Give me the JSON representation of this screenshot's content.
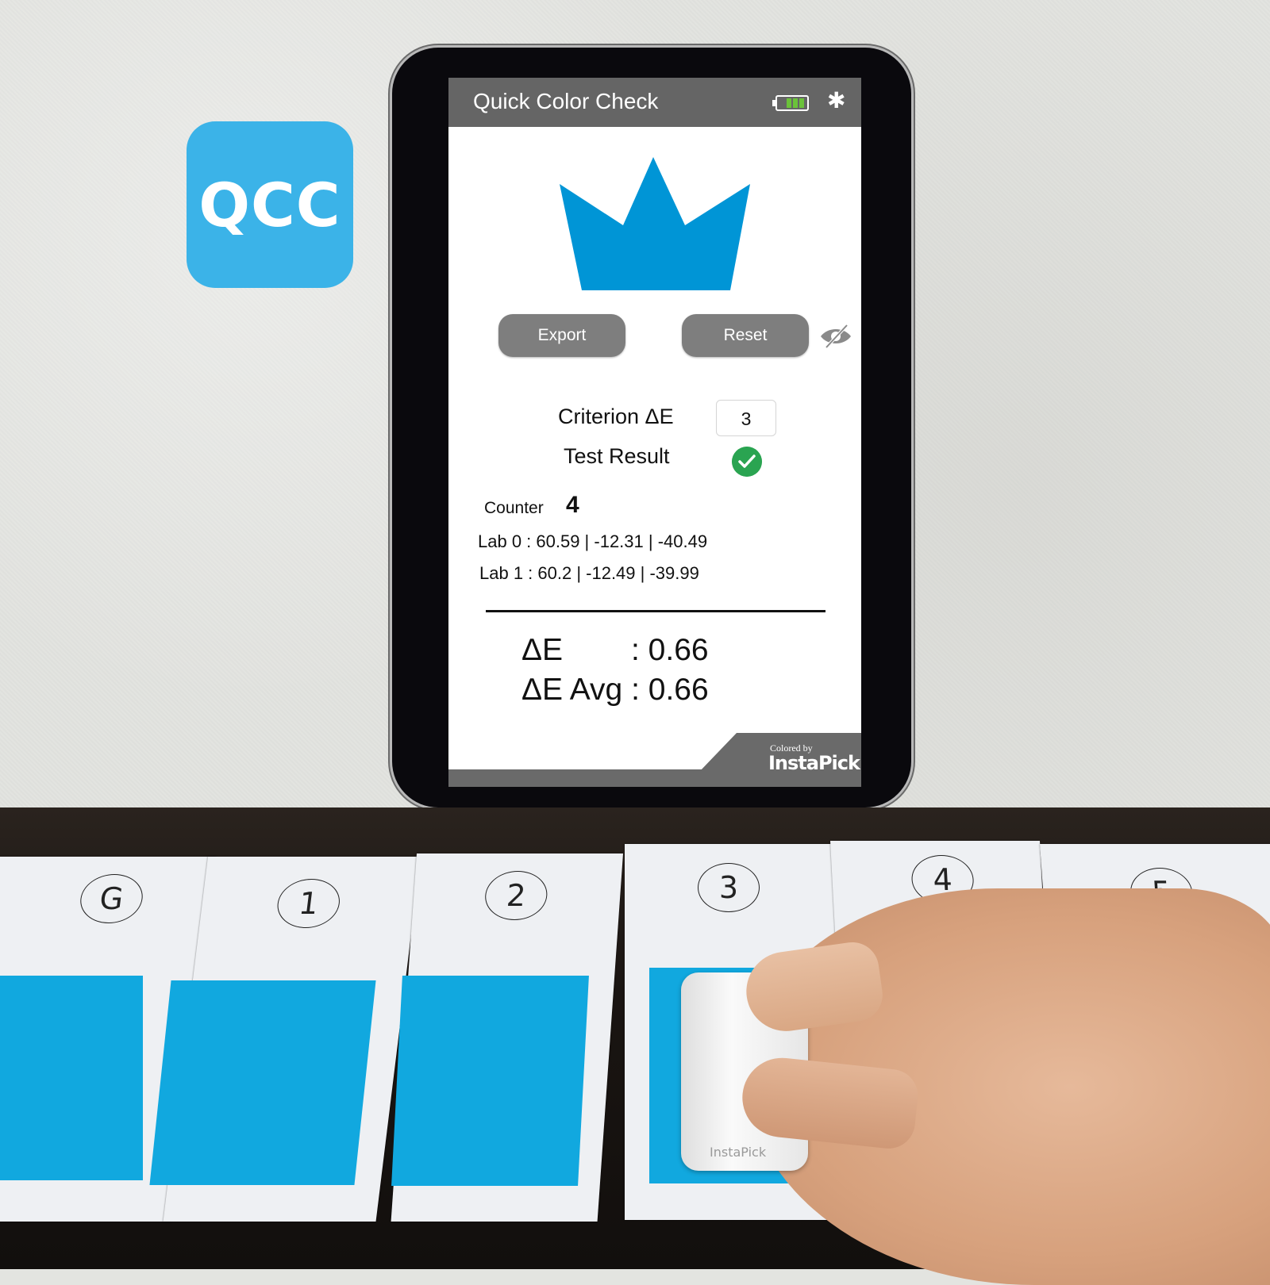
{
  "app_icon": {
    "label": "QCC",
    "color": "#3bb3e8"
  },
  "app": {
    "title": "Quick Color Check",
    "status_icons": [
      "battery-icon",
      "bluetooth-icon"
    ],
    "battery_level_bars": 3,
    "battery_level_max": 3,
    "result_icon": "crown-icon",
    "accent_color": "#0095d6",
    "buttons": {
      "export": "Export",
      "reset": "Reset"
    },
    "visibility_toggle_icon": "eye-slash-icon",
    "criterion": {
      "label": "Criterion ΔE",
      "value": "3"
    },
    "test_result": {
      "label": "Test Result",
      "status": "pass",
      "color": "#2aa451"
    },
    "counter": {
      "label": "Counter",
      "value": "4"
    },
    "lab0": "Lab 0 : 60.59 | -12.31 | -40.49",
    "lab1": "Lab 1 : 60.2 | -12.49 | -39.99",
    "delta_e": {
      "label": "ΔE",
      "value": ": 0.66"
    },
    "delta_e_avg": {
      "label": "ΔE Avg",
      "value": ": 0.66"
    },
    "footer": {
      "colored_by": "Colored by",
      "brand": "InstaPick"
    }
  },
  "cards": [
    {
      "label": "G"
    },
    {
      "label": "1"
    },
    {
      "label": "2"
    },
    {
      "label": "3"
    },
    {
      "label": "4"
    },
    {
      "label": "5"
    }
  ],
  "device": {
    "brand": "InstaPick"
  }
}
